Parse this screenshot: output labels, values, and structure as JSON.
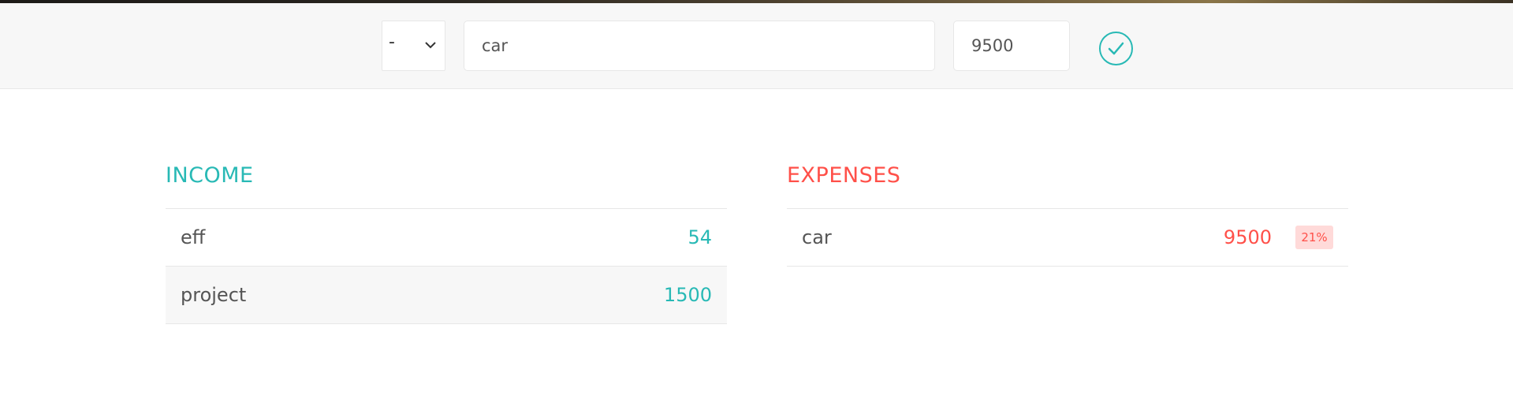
{
  "add_bar": {
    "type_value": "-",
    "description_value": "car",
    "value_value": "9500"
  },
  "colors": {
    "income": "#28b9b5",
    "expense": "#ff5049",
    "expense_badge_bg": "#ffdad9"
  },
  "icons": {
    "confirm": "checkmark-circle-icon",
    "type_dropdown": "chevron-down-icon"
  },
  "income": {
    "title": "INCOME",
    "items": [
      {
        "description": "eff",
        "value": "54"
      },
      {
        "description": "project",
        "value": "1500"
      }
    ]
  },
  "expenses": {
    "title": "EXPENSES",
    "items": [
      {
        "description": "car",
        "value": "9500",
        "percentage": "21%"
      }
    ]
  }
}
